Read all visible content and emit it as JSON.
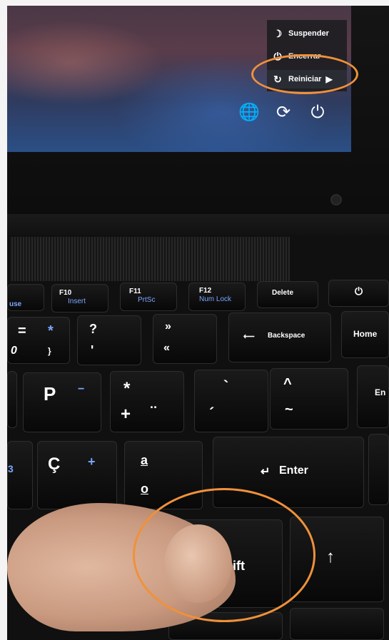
{
  "screen": {
    "power_menu": {
      "items": [
        {
          "icon": "moon-icon",
          "label": "Suspender"
        },
        {
          "icon": "power-icon",
          "label": "Encerrar"
        },
        {
          "icon": "restart-icon",
          "label": "Reiniciar"
        }
      ],
      "selected": "Reiniciar"
    },
    "bottom_icons": [
      "network-icon",
      "accessibility-icon",
      "power-icon"
    ]
  },
  "keyboard": {
    "function_row": [
      {
        "top": "F10",
        "sub": "Insert"
      },
      {
        "top": "F11",
        "sub": "PrtSc"
      },
      {
        "top": "F12",
        "sub": "Num Lock"
      },
      {
        "top": "Delete",
        "sub": ""
      },
      {
        "top": "⏻",
        "sub": ""
      }
    ],
    "partial_left_label": "use",
    "row2": {
      "eq_top": "=",
      "eq_blue": "*",
      "zero": "0",
      "brace": "}",
      "q_top": "?",
      "q_bottom": "'",
      "guill_top": "»",
      "guill_bottom": "«",
      "backspace": "Backspace",
      "home": "Home"
    },
    "row3": {
      "p": "P",
      "p_blue": "−",
      "ast_top": "*",
      "ast_bottom": "+",
      "diaer": "¨",
      "acute_top": "`",
      "acute_bottom": "´",
      "caret_top": "^",
      "caret_bottom": "~",
      "end_partial": "En"
    },
    "row4": {
      "c_cedilla": "Ç",
      "c_blue": "+",
      "a_ord": "a",
      "o_ord": "o",
      "enter": "Enter"
    },
    "row5": {
      "shift": "Shift",
      "up_arrow": "↑"
    }
  },
  "annotation_color": "#f0913a"
}
